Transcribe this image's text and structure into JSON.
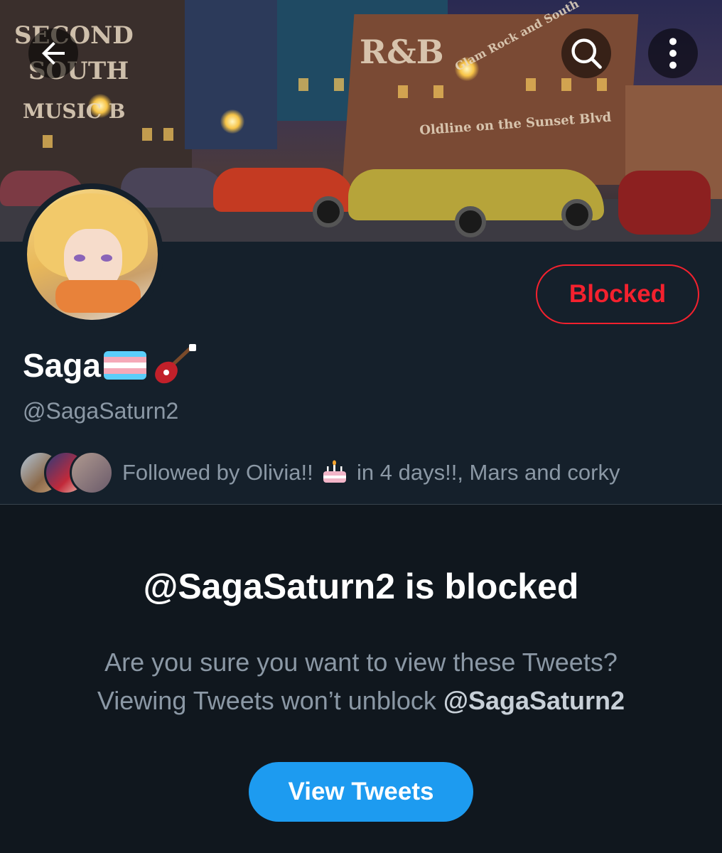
{
  "header": {
    "back_icon": "arrow-left-icon",
    "search_icon": "search-icon",
    "more_icon": "more-vertical-icon"
  },
  "banner": {
    "signs": [
      "SECOND",
      "SOUTH",
      "MUSIC B",
      "R&B",
      "Glam Rock and South",
      "Oldline on the Sunset Blvd"
    ]
  },
  "profile": {
    "display_name": "Saga",
    "name_emojis": [
      "transgender-flag-icon",
      "guitar-icon"
    ],
    "handle": "@SagaSaturn2",
    "relationship_button": "Blocked",
    "followed_by": {
      "prefix": "Followed by Olivia!!",
      "emoji": "birthday-cake-icon",
      "suffix": "in 4 days!!, Mars and corky"
    }
  },
  "blocked_notice": {
    "title": "@SagaSaturn2 is blocked",
    "line1": "Are you sure you want to view these Tweets?",
    "line2_prefix": "Viewing Tweets won’t unblock",
    "line2_handle": "@SagaSaturn2",
    "button": "View Tweets"
  },
  "colors": {
    "background": "#15202b",
    "lower_background": "#10171e",
    "accent": "#1d9bf0",
    "danger": "#f4212e",
    "secondary_text": "#8b98a5"
  }
}
